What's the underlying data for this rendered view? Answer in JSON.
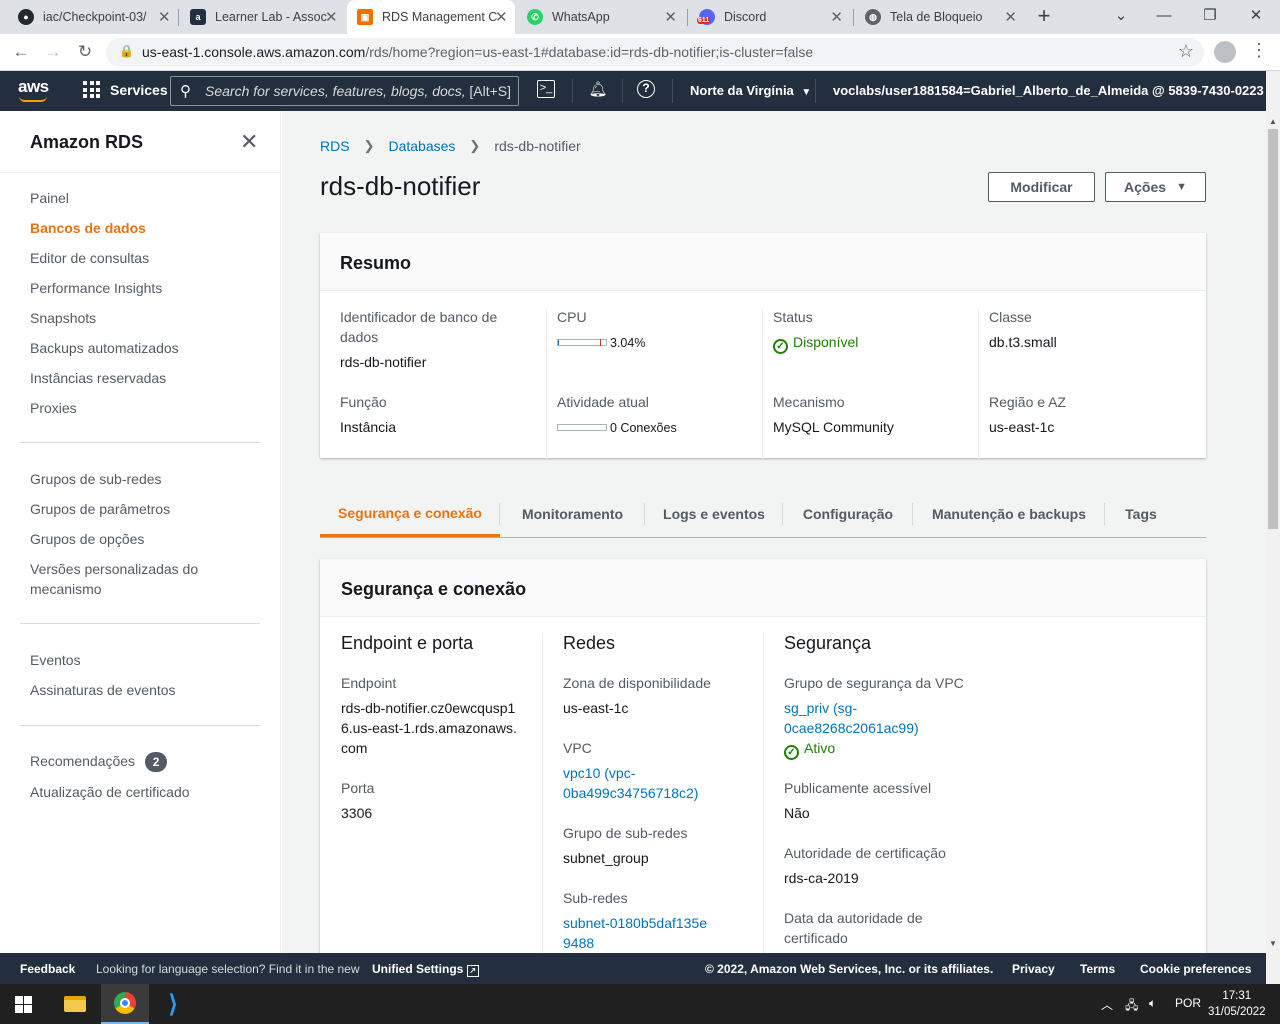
{
  "browser": {
    "tabs": [
      {
        "title": "iac/Checkpoint-03/",
        "icon": "github-icon"
      },
      {
        "title": "Learner Lab - Assoc",
        "icon": "aws-icon"
      },
      {
        "title": "RDS Management C",
        "icon": "rds-icon",
        "active": true
      },
      {
        "title": "WhatsApp",
        "icon": "whatsapp-icon"
      },
      {
        "title": "Discord",
        "icon": "discord-icon",
        "badge": "611"
      },
      {
        "title": "Tela de Bloqueio",
        "icon": "globe-icon"
      }
    ],
    "url_host": "us-east-1.console.aws.amazon.com",
    "url_path": "/rds/home?region=us-east-1#database:id=rds-db-notifier;is-cluster=false"
  },
  "awsnav": {
    "logo": "aws",
    "services": "Services",
    "search_placeholder": "Search for services, features, blogs, docs,",
    "search_shortcut": "[Alt+S]",
    "region": "Norte da Virgínia",
    "account": "voclabs/user1881584=Gabriel_Alberto_de_Almeida @ 5839-7430-0223"
  },
  "sidebar": {
    "title": "Amazon RDS",
    "group1": [
      "Painel",
      "Bancos de dados",
      "Editor de consultas",
      "Performance Insights",
      "Snapshots",
      "Backups automatizados",
      "Instâncias reservadas",
      "Proxies"
    ],
    "group2": [
      "Grupos de sub-redes",
      "Grupos de parâmetros",
      "Grupos de opções",
      "Versões personalizadas do mecanismo"
    ],
    "group3": [
      "Eventos",
      "Assinaturas de eventos"
    ],
    "group4": [
      "Recomendações",
      "Atualização de certificado"
    ],
    "recommendations_count": "2",
    "active_item": "Bancos de dados"
  },
  "breadcrumb": [
    "RDS",
    "Databases",
    "rds-db-notifier"
  ],
  "page_title": "rds-db-notifier",
  "buttons": {
    "modify": "Modificar",
    "actions": "Ações"
  },
  "summary": {
    "title": "Resumo",
    "id_label": "Identificador de banco de dados",
    "id_value": "rds-db-notifier",
    "cpu_label": "CPU",
    "cpu_value": "3.04%",
    "cpu_fraction": 0.0304,
    "status_label": "Status",
    "status_value": "Disponível",
    "class_label": "Classe",
    "class_value": "db.t3.small",
    "role_label": "Função",
    "role_value": "Instância",
    "activity_label": "Atividade atual",
    "activity_value": "0 Conexões",
    "engine_label": "Mecanismo",
    "engine_value": "MySQL Community",
    "region_label": "Região e AZ",
    "region_value": "us-east-1c"
  },
  "tabs": [
    "Segurança e conexão",
    "Monitoramento",
    "Logs e eventos",
    "Configuração",
    "Manutenção e backups",
    "Tags"
  ],
  "connectivity": {
    "title": "Segurança e conexão",
    "endpoint_section": "Endpoint e porta",
    "endpoint_label": "Endpoint",
    "endpoint_value": "rds-db-notifier.cz0ewcqusp16.us-east-1.rds.amazonaws.com",
    "port_label": "Porta",
    "port_value": "3306",
    "network_section": "Redes",
    "az_label": "Zona de disponibilidade",
    "az_value": "us-east-1c",
    "vpc_label": "VPC",
    "vpc_value": "vpc10 (vpc-0ba499c34756718c2)",
    "subnet_group_label": "Grupo de sub-redes",
    "subnet_group_value": "subnet_group",
    "subnets_label": "Sub-redes",
    "subnets_value": "subnet-0180b5daf135e9488",
    "security_section": "Segurança",
    "sg_label": "Grupo de segurança da VPC",
    "sg_value": "sg_priv (sg-0cae8268c2061ac99)",
    "sg_status": "Ativo",
    "public_label": "Publicamente acessível",
    "public_value": "Não",
    "ca_label": "Autoridade de certificação",
    "ca_value": "rds-ca-2019",
    "ca_date_label": "Data da autoridade de certificado"
  },
  "footer": {
    "feedback": "Feedback",
    "lang_text": "Looking for language selection? Find it in the new",
    "unified": "Unified Settings",
    "copyright": "© 2022, Amazon Web Services, Inc. or its affiliates.",
    "privacy": "Privacy",
    "terms": "Terms",
    "cookies": "Cookie preferences"
  },
  "taskbar": {
    "lang": "POR",
    "time": "17:31",
    "date": "31/05/2022"
  },
  "colors": {
    "aws_nav": "#232f3e",
    "accent_orange": "#ec7211",
    "link_blue": "#0073bb",
    "success_green": "#1d8102"
  }
}
